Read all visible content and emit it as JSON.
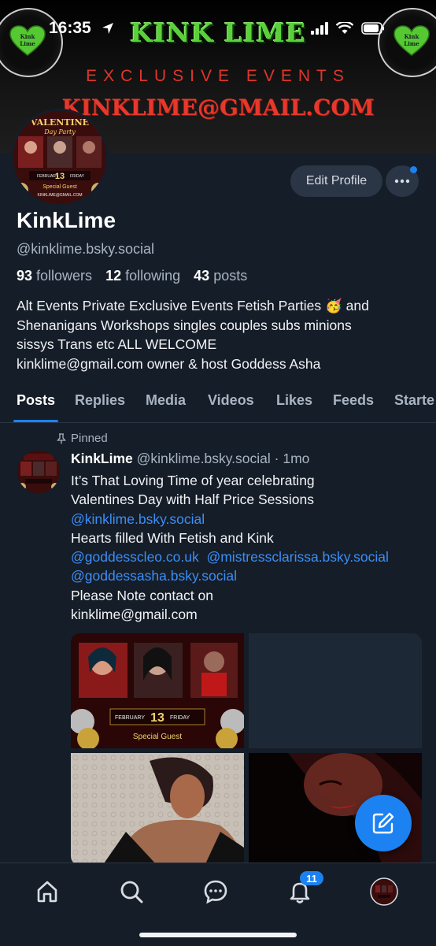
{
  "status_bar": {
    "time": "16:35"
  },
  "banner": {
    "title": "KINK LIME",
    "subtitle": "EXCLUSIVE EVENTS",
    "email": "KINKLIME@GMAIL.COM",
    "logo_text_top": "Kink",
    "logo_text_bottom": "Lime"
  },
  "profile": {
    "name": "KinkLime",
    "handle": "@kinklime.bsky.social",
    "followers_count": "93",
    "followers_label": "followers",
    "following_count": "12",
    "following_label": "following",
    "posts_count": "43",
    "posts_label": "posts",
    "bio_line1": "Alt Events Private Exclusive Events Fetish Parties 🥳 and",
    "bio_line2": "Shenanigans Workshops singles couples subs minions",
    "bio_line3": "sissys Trans etc ALL WELCOME",
    "bio_line4": "kinklime@gmail.com owner & host Goddess Asha",
    "edit_button": "Edit Profile"
  },
  "avatar_flyer": {
    "title": "VALENTINE",
    "subtitle": "Day Party",
    "date_left": "FEBRUARY",
    "date_num": "13",
    "date_right": "FRIDAY",
    "guest": "Special Guest",
    "email": "KINKLIME@GMAIL.COM"
  },
  "tabs": [
    "Posts",
    "Replies",
    "Media",
    "Videos",
    "Likes",
    "Feeds",
    "Starte"
  ],
  "post": {
    "pinned_label": "Pinned",
    "author": "KinkLime",
    "author_handle": "@kinklime.bsky.social",
    "time": "· 1mo",
    "line1": "It’s That Loving Time of year celebrating",
    "line2": "Valentines Day with Half Price Sessions",
    "mention1": "@kinklime.bsky.social",
    "line3": "Hearts filled With Fetish and Kink",
    "mention2": "@goddesscleo.co.uk",
    "mention3": "@mistressclarissa.bsky.social",
    "mention4": "@goddessasha.bsky.social",
    "line4": "Please Note contact on",
    "line5": "kinklime@gmail.com",
    "flyer": {
      "date_left": "FEBRUARY",
      "date_num": "13",
      "date_right": "FRIDAY",
      "guest": "Special Guest"
    }
  },
  "bottom_nav": {
    "notifications_badge": "11"
  },
  "colors": {
    "accent": "#1c82f2",
    "background": "#151d28",
    "banner_green": "#5cd03a",
    "banner_red": "#e0352b"
  }
}
